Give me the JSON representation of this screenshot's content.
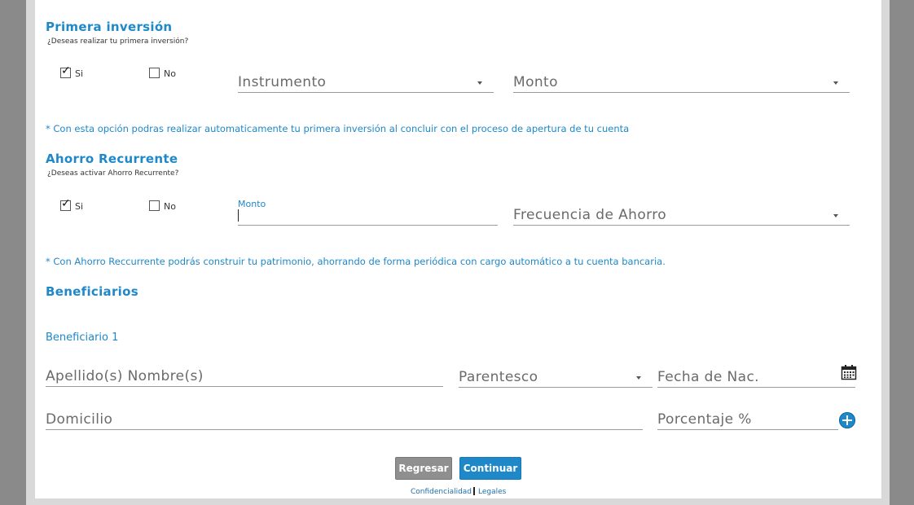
{
  "primera": {
    "title": "Primera inversión",
    "question": "¿Deseas realizar tu primera inversión?",
    "yes_label": "Si",
    "no_label": "No",
    "yes_checked": true,
    "no_checked": false,
    "instrumento_placeholder": "Instrumento",
    "monto_placeholder": "Monto",
    "note": "* Con esta opción podras realizar automaticamente tu primera inversión al concluir con el proceso de apertura de tu cuenta"
  },
  "ahorro": {
    "title": "Ahorro Recurrente",
    "question": "¿Deseas activar Ahorro Recurrente?",
    "yes_label": "Si",
    "no_label": "No",
    "yes_checked": true,
    "no_checked": false,
    "monto_label": "Monto",
    "monto_value": "",
    "frecuencia_placeholder": "Frecuencia de Ahorro",
    "note": "* Con Ahorro Reccurrente podrás construir tu patrimonio, ahorrando de forma periódica con cargo automático a tu cuenta bancaria."
  },
  "beneficiarios": {
    "title": "Beneficiarios",
    "subtitle": "Beneficiario 1",
    "nombre_placeholder": "Apellido(s) Nombre(s)",
    "parentesco_placeholder": "Parentesco",
    "fecha_placeholder": "Fecha de Nac.",
    "domicilio_placeholder": "Domicilio",
    "porcentaje_placeholder": "Porcentaje %"
  },
  "buttons": {
    "back": "Regresar",
    "next": "Continuar"
  },
  "footer": {
    "privacy": "Confidencialidad",
    "legal": "Legales"
  },
  "colors": {
    "accent": "#1e88c9",
    "button_gray": "#8f8f8f"
  },
  "icons": {
    "calendar": "calendar-icon",
    "add": "plus-circle-icon"
  }
}
